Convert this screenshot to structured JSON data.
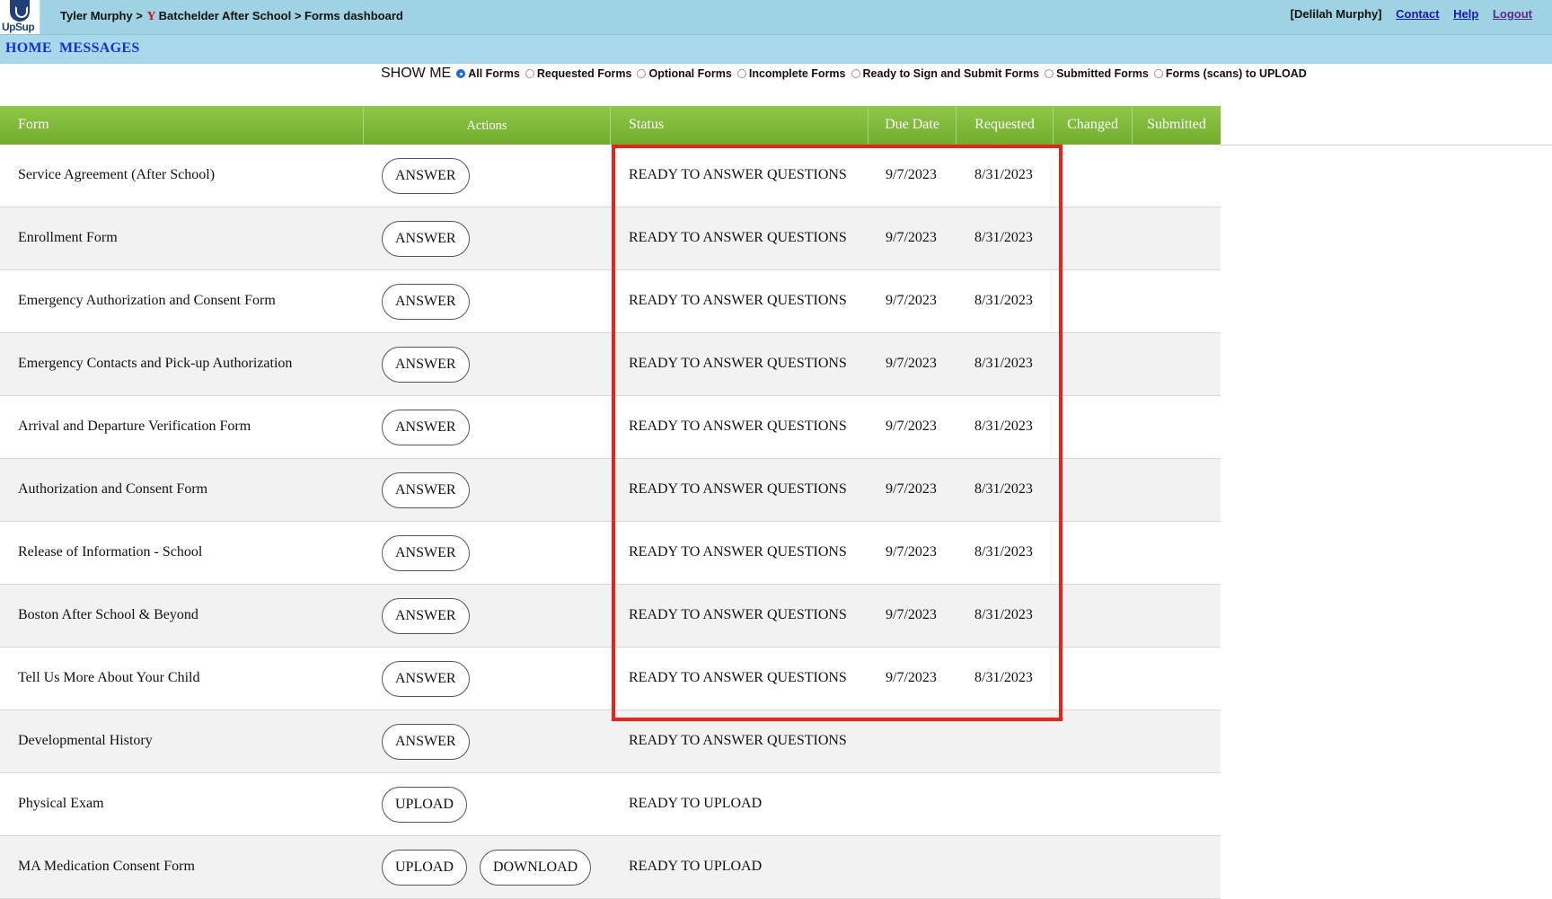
{
  "header": {
    "logo_text": "UpSup",
    "breadcrumb_user": "Tyler Murphy >",
    "ymca_glyph": "Y",
    "breadcrumb_rest": "Batchelder After School > Forms dashboard",
    "account_user": "[Delilah Murphy]",
    "links": {
      "contact": "Contact",
      "help": "Help",
      "logout": "Logout"
    }
  },
  "nav": {
    "home": "HOME",
    "messages": "MESSAGES"
  },
  "filters": {
    "label": "SHOW ME",
    "options": [
      {
        "label": "All Forms",
        "selected": true
      },
      {
        "label": "Requested Forms",
        "selected": false
      },
      {
        "label": "Optional Forms",
        "selected": false
      },
      {
        "label": "Incomplete Forms",
        "selected": false
      },
      {
        "label": "Ready to Sign and Submit Forms",
        "selected": false
      },
      {
        "label": "Submitted Forms",
        "selected": false
      },
      {
        "label": "Forms (scans) to UPLOAD",
        "selected": false
      }
    ]
  },
  "table": {
    "columns": [
      "Form",
      "Actions",
      "Status",
      "Due Date",
      "Requested",
      "Changed",
      "Submitted"
    ],
    "rows": [
      {
        "form": "Service Agreement (After School)",
        "actions": [
          "ANSWER"
        ],
        "status": "READY TO ANSWER QUESTIONS",
        "due": "9/7/2023",
        "requested": "8/31/2023",
        "changed": "",
        "submitted": ""
      },
      {
        "form": "Enrollment Form",
        "actions": [
          "ANSWER"
        ],
        "status": "READY TO ANSWER QUESTIONS",
        "due": "9/7/2023",
        "requested": "8/31/2023",
        "changed": "",
        "submitted": ""
      },
      {
        "form": "Emergency Authorization and Consent Form",
        "actions": [
          "ANSWER"
        ],
        "status": "READY TO ANSWER QUESTIONS",
        "due": "9/7/2023",
        "requested": "8/31/2023",
        "changed": "",
        "submitted": ""
      },
      {
        "form": "Emergency Contacts and Pick-up Authorization",
        "actions": [
          "ANSWER"
        ],
        "status": "READY TO ANSWER QUESTIONS",
        "due": "9/7/2023",
        "requested": "8/31/2023",
        "changed": "",
        "submitted": ""
      },
      {
        "form": "Arrival and Departure Verification Form",
        "actions": [
          "ANSWER"
        ],
        "status": "READY TO ANSWER QUESTIONS",
        "due": "9/7/2023",
        "requested": "8/31/2023",
        "changed": "",
        "submitted": ""
      },
      {
        "form": "Authorization and Consent Form",
        "actions": [
          "ANSWER"
        ],
        "status": "READY TO ANSWER QUESTIONS",
        "due": "9/7/2023",
        "requested": "8/31/2023",
        "changed": "",
        "submitted": ""
      },
      {
        "form": "Release of Information - School",
        "actions": [
          "ANSWER"
        ],
        "status": "READY TO ANSWER QUESTIONS",
        "due": "9/7/2023",
        "requested": "8/31/2023",
        "changed": "",
        "submitted": ""
      },
      {
        "form": "Boston After School & Beyond",
        "actions": [
          "ANSWER"
        ],
        "status": "READY TO ANSWER QUESTIONS",
        "due": "9/7/2023",
        "requested": "8/31/2023",
        "changed": "",
        "submitted": ""
      },
      {
        "form": "Tell Us More About Your Child",
        "actions": [
          "ANSWER"
        ],
        "status": "READY TO ANSWER QUESTIONS",
        "due": "9/7/2023",
        "requested": "8/31/2023",
        "changed": "",
        "submitted": ""
      },
      {
        "form": "Developmental History",
        "actions": [
          "ANSWER"
        ],
        "status": "READY TO ANSWER QUESTIONS",
        "due": "",
        "requested": "",
        "changed": "",
        "submitted": ""
      },
      {
        "form": "Physical Exam",
        "actions": [
          "UPLOAD"
        ],
        "status": "READY TO UPLOAD",
        "due": "",
        "requested": "",
        "changed": "",
        "submitted": ""
      },
      {
        "form": "MA Medication Consent Form",
        "actions": [
          "UPLOAD",
          "DOWNLOAD"
        ],
        "status": "READY TO UPLOAD",
        "due": "",
        "requested": "",
        "changed": "",
        "submitted": ""
      }
    ]
  },
  "colors": {
    "topbar": "#9fd3e3",
    "navbar": "#a8d8ea",
    "table_header": "#7ab83a",
    "highlight_box": "#e8231c",
    "link": "#1a1aa6"
  }
}
